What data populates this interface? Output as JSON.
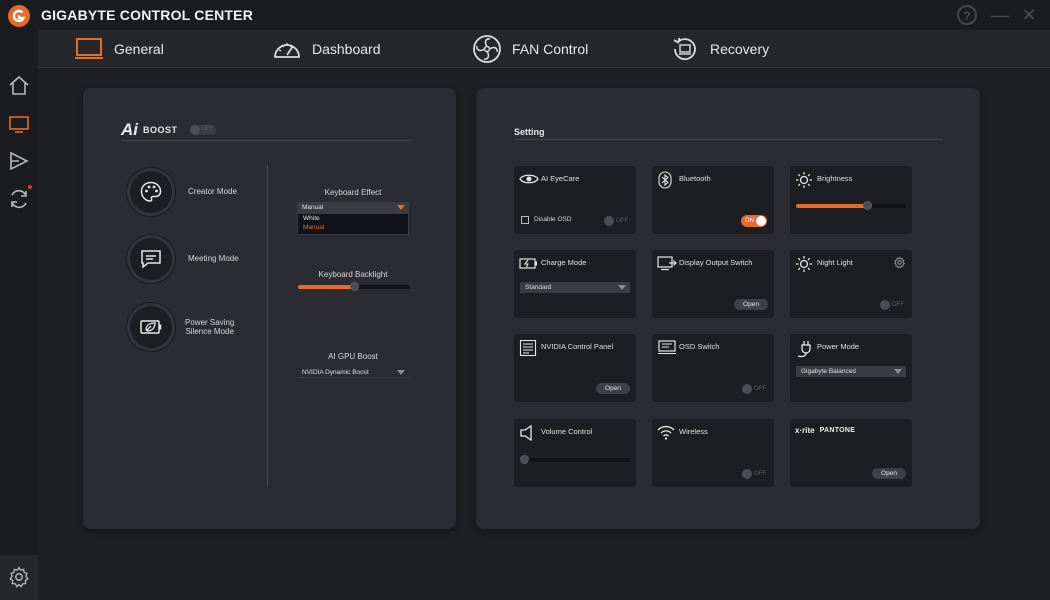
{
  "app": {
    "title": "GIGABYTE CONTROL CENTER",
    "help_label": "?",
    "minimize_label": "—",
    "close_label": "✕"
  },
  "colors": {
    "accent": "#e46b2a",
    "panel": "#2b2c31",
    "card": "#1d1e21",
    "background": "#1e1f22"
  },
  "tabs": [
    {
      "label": "General",
      "icon": "monitor-icon"
    },
    {
      "label": "Dashboard",
      "icon": "gauge-icon"
    },
    {
      "label": "FAN Control",
      "icon": "fan-icon"
    },
    {
      "label": "Recovery",
      "icon": "recovery-icon"
    }
  ],
  "sidebar": {
    "items": [
      "home-icon",
      "monitor-icon",
      "play-icon",
      "sync-icon"
    ],
    "settings": "gear-icon"
  },
  "ai_boost": {
    "mark": "Ai",
    "label": "BOOST",
    "toggle": "OFF",
    "enabled": false
  },
  "modes": [
    {
      "label": "Creator Mode",
      "icon": "palette-icon"
    },
    {
      "label": "Meeting Mode",
      "icon": "chat-icon"
    },
    {
      "label": "Power Saving\nSilence Mode",
      "icon": "battery-leaf-icon"
    }
  ],
  "keyboard_effect": {
    "label": "Keyboard Effect",
    "value": "Manual",
    "options": [
      "White",
      "Manual"
    ]
  },
  "keyboard_backlight": {
    "label": "Keyboard Backlight",
    "level": 0.5
  },
  "ai_gpu_boost": {
    "label": "AI GPU Boost",
    "value": "NVIDIA Dynamic Boost"
  },
  "setting": {
    "title": "Setting",
    "ai_eyecare": {
      "title": "AI EyeCare",
      "checkbox_label": "Disable OSD",
      "toggle": "OFF"
    },
    "bluetooth": {
      "title": "Bluetooth",
      "toggle": "ON"
    },
    "brightness": {
      "title": "Brightness",
      "level": 0.6
    },
    "charge_mode": {
      "title": "Charge Mode",
      "value": "Standard"
    },
    "display_output": {
      "title": "Display Output Switch",
      "button": "Open"
    },
    "night_light": {
      "title": "Night Light",
      "toggle": "OFF"
    },
    "nvidia_panel": {
      "title": "NVIDIA Control Panel",
      "button": "Open"
    },
    "osd_switch": {
      "title": "OSD Switch",
      "toggle": "OFF"
    },
    "power_mode": {
      "title": "Power Mode",
      "value": "Gigabyte Balanced"
    },
    "volume": {
      "title": "Volume Control",
      "level": 0.0
    },
    "wireless": {
      "title": "Wireless",
      "toggle": "OFF"
    },
    "xrite": {
      "brand": "x·rite",
      "pantone": "PANTONE",
      "button": "Open"
    }
  }
}
